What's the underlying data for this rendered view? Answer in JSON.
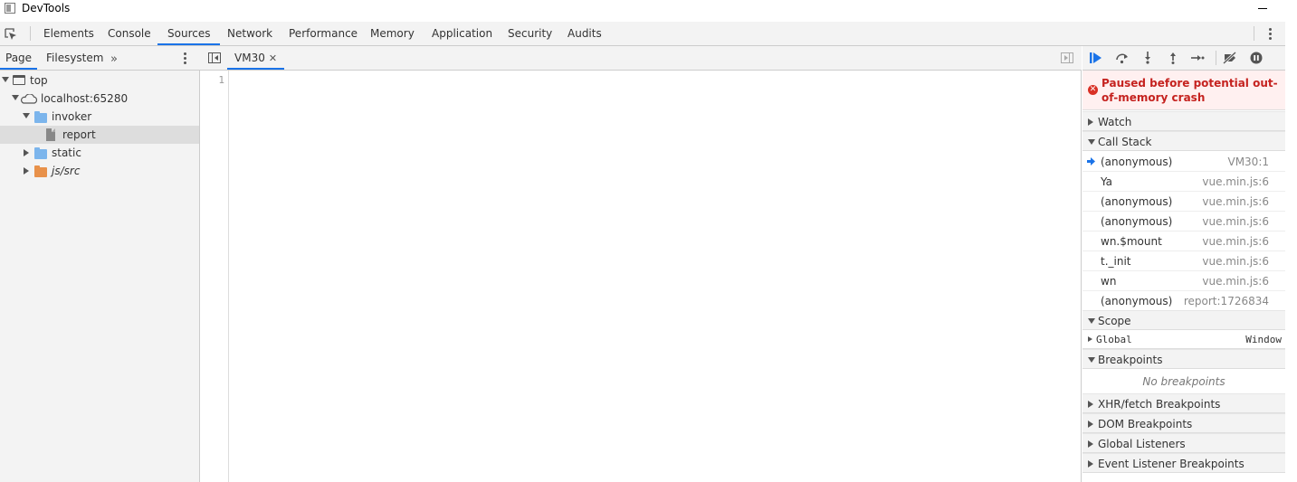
{
  "window": {
    "title": "DevTools"
  },
  "main_tabs": [
    "Elements",
    "Console",
    "Sources",
    "Network",
    "Performance",
    "Memory",
    "Application",
    "Security",
    "Audits"
  ],
  "active_main_tab": "Sources",
  "navigator": {
    "tabs": [
      "Page",
      "Filesystem"
    ],
    "active_tab": "Page",
    "more_glyph": "»",
    "tree": [
      {
        "label": "top",
        "icon": "frame-icon"
      },
      {
        "label": "localhost:65280",
        "icon": "cloud-icon"
      },
      {
        "label": "invoker",
        "icon": "folder-icon"
      },
      {
        "label": "report",
        "icon": "file-icon",
        "selected": true
      },
      {
        "label": "static",
        "icon": "folder-icon"
      },
      {
        "label": "js/src",
        "icon": "folder-icon",
        "color": "#e8914a"
      }
    ]
  },
  "editor": {
    "tab_label": "VM30",
    "close_glyph": "✕",
    "line_number": "1"
  },
  "debugger": {
    "paused_message": "Paused before potential out-of-memory crash",
    "sections": {
      "watch": "Watch",
      "call_stack": "Call Stack",
      "scope": "Scope",
      "breakpoints": "Breakpoints",
      "xhr": "XHR/fetch Breakpoints",
      "dom": "DOM Breakpoints",
      "global_listeners": "Global Listeners",
      "event_listeners": "Event Listener Breakpoints"
    },
    "call_stack": [
      {
        "fn": "(anonymous)",
        "loc": "VM30:1",
        "current": true
      },
      {
        "fn": "Ya",
        "loc": "vue.min.js:6"
      },
      {
        "fn": "(anonymous)",
        "loc": "vue.min.js:6"
      },
      {
        "fn": "(anonymous)",
        "loc": "vue.min.js:6"
      },
      {
        "fn": "wn.$mount",
        "loc": "vue.min.js:6"
      },
      {
        "fn": "t._init",
        "loc": "vue.min.js:6"
      },
      {
        "fn": "wn",
        "loc": "vue.min.js:6"
      },
      {
        "fn": "(anonymous)",
        "loc": "report:1726834"
      }
    ],
    "scope": {
      "key": "Global",
      "value": "Window"
    },
    "no_breakpoints": "No breakpoints"
  },
  "colors": {
    "accent": "#1a73e8",
    "error": "#d93025",
    "paused_bg": "#fff0f0"
  }
}
